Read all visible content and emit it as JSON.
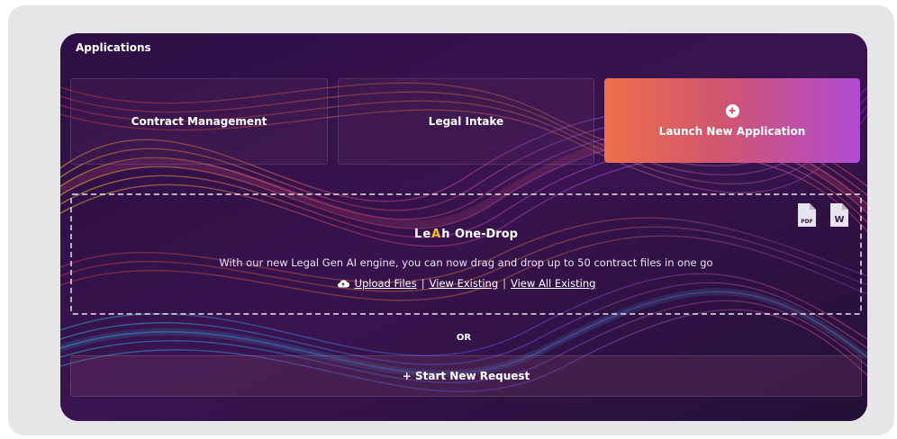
{
  "section": {
    "title": "Applications"
  },
  "cards": [
    {
      "label": "Contract Management"
    },
    {
      "label": "Legal Intake"
    },
    {
      "label": "Launch New Application"
    }
  ],
  "dropzone": {
    "brand_pre": "Le",
    "brand_highlight": "A",
    "brand_post": "h",
    "product": "One-Drop",
    "description": "With our new Legal Gen AI engine, you can now drag and drop up to 50 contract files in one go",
    "upload_label": "Upload Files",
    "separator": "|",
    "view_existing_label": "View Existing",
    "view_all_label": "View All Existing",
    "pdf_icon_text": "PDF",
    "word_icon_text": "W"
  },
  "or_text": "OR",
  "start_request_label": "+ Start New Request",
  "colors": {
    "launch_gradient_start": "#ee6f4a",
    "launch_gradient_end": "#b24bd4",
    "brand_highlight": "#f3c624",
    "panel_bg": "#2a1242"
  }
}
